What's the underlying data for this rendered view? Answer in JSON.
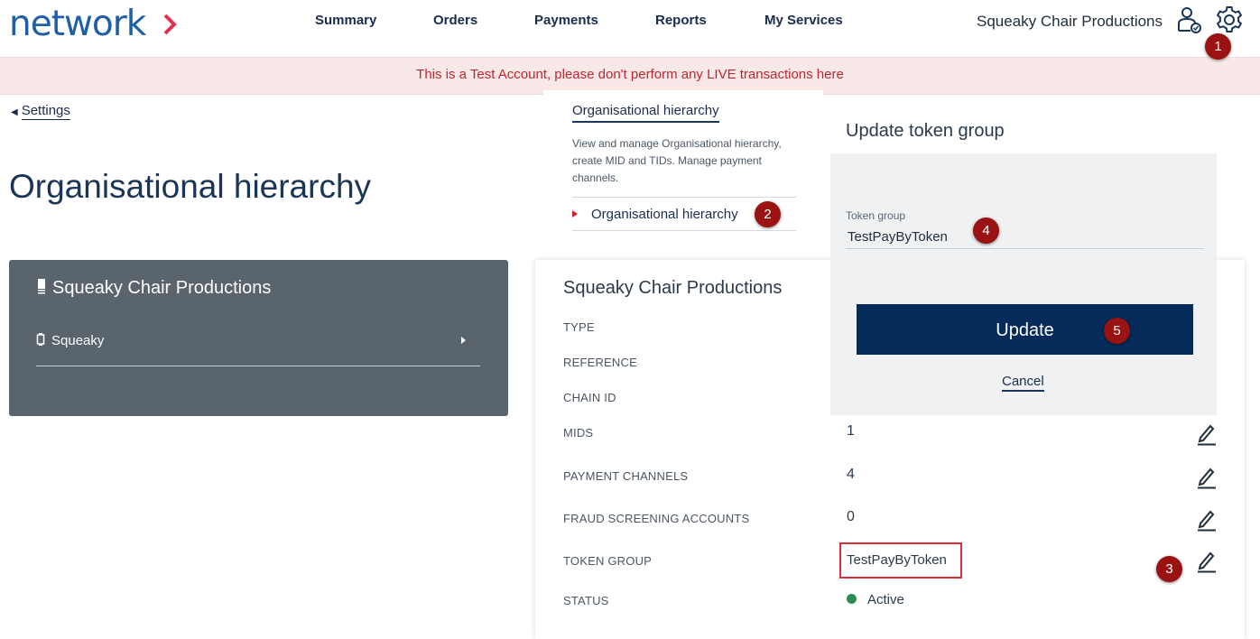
{
  "header": {
    "logo_text": "network",
    "nav": [
      "Summary",
      "Orders",
      "Payments",
      "Reports",
      "My Services"
    ],
    "company_name": "Squeaky Chair Productions"
  },
  "banner": {
    "text": "This is a Test Account, please don't perform any LIVE transactions here"
  },
  "back_link": {
    "label": "Settings"
  },
  "page_title": "Organisational hierarchy",
  "tree": {
    "top_node": "Squeaky Chair Productions",
    "child_node": "Squeaky"
  },
  "settings_menu": {
    "title": "Organisational hierarchy",
    "description": "View and manage Organisational hierarchy, create MID and TIDs. Manage payment channels.",
    "item": "Organisational hierarchy"
  },
  "details": {
    "title": "Squeaky Chair Productions",
    "rows": [
      {
        "label": "TYPE",
        "value": ""
      },
      {
        "label": "REFERENCE",
        "value": ""
      },
      {
        "label": "CHAIN ID",
        "value": ""
      },
      {
        "label": "MIDS",
        "value": "1"
      },
      {
        "label": "PAYMENT CHANNELS",
        "value": "4"
      },
      {
        "label": "FRAUD SCREENING ACCOUNTS",
        "value": "0"
      },
      {
        "label": "TOKEN GROUP",
        "value": "TestPayByToken"
      },
      {
        "label": "STATUS",
        "value": "Active"
      }
    ]
  },
  "update_panel": {
    "title": "Update token group",
    "field_label": "Token group",
    "field_value": "TestPayByToken",
    "update_label": "Update",
    "cancel_label": "Cancel"
  },
  "markers": [
    "1",
    "2",
    "3",
    "4",
    "5"
  ],
  "colors": {
    "brand": "#1f5fa6",
    "accent": "#e3324f",
    "button": "#052b5a",
    "marker": "#9b1212",
    "status_active": "#2e8b57"
  }
}
